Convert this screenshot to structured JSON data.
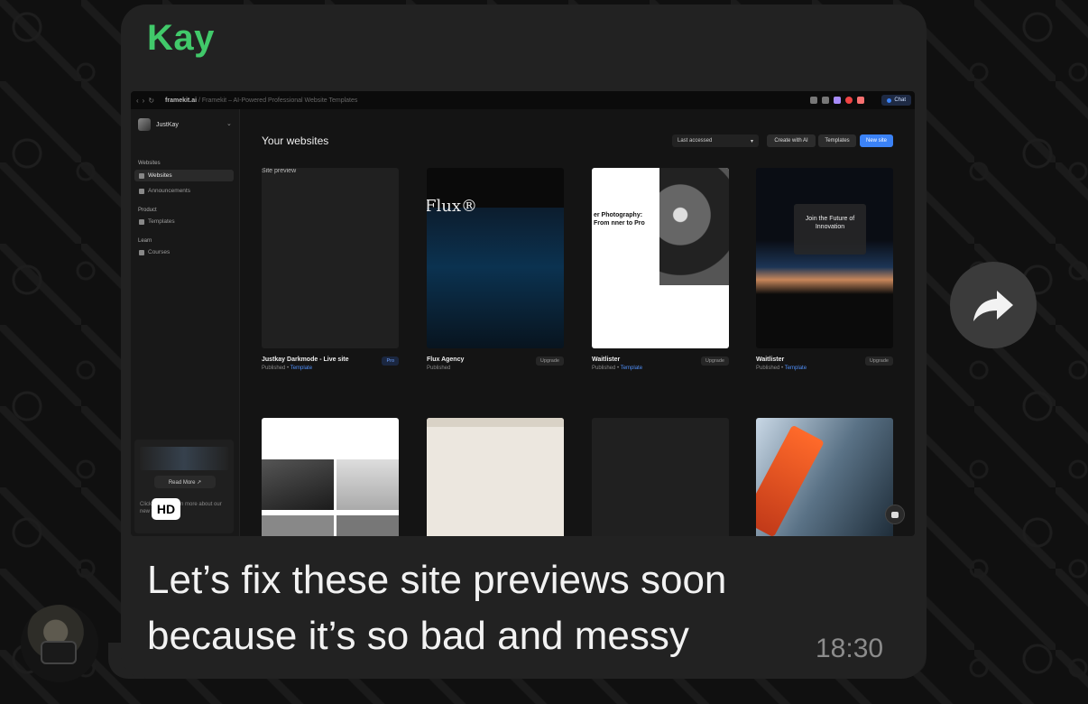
{
  "message": {
    "sender": "Kay",
    "text_lines": [
      "Let’s fix these site previews soon",
      "because it’s so bad and messy"
    ],
    "time": "18:30",
    "hd_badge": "HD"
  },
  "screenshot": {
    "browser": {
      "domain": "framekit.ai",
      "title": " / Framekit – AI-Powered Professional Website Templates",
      "chat_label": "Chat"
    },
    "sidebar": {
      "user": "JustKay",
      "sections": [
        {
          "title": "Websites",
          "items": [
            "Websites",
            "Announcements"
          ]
        },
        {
          "title": "Product",
          "items": [
            "Templates"
          ]
        },
        {
          "title": "Learn",
          "items": [
            "Courses"
          ]
        }
      ],
      "promo": {
        "button": "Read More ↗",
        "text": "Click here to learn more about our new features."
      }
    },
    "main": {
      "title": "Your websites",
      "sort_label": "Last accessed",
      "create_ai": "Create with AI",
      "templates": "Templates",
      "new_site": "New site"
    },
    "cards": [
      {
        "name": "Justkay Darkmode - Live site",
        "status": "Published • ",
        "link": "Template",
        "badge": "Pro",
        "img_alt": "Site preview"
      },
      {
        "name": "Flux Agency",
        "status": "Published",
        "link": "",
        "badge": "Upgrade",
        "logo": "Flux®"
      },
      {
        "name": "Waitlister",
        "status": "Published • ",
        "link": "Template",
        "badge": "Upgrade",
        "headline": "er Photography: From nner to Pro"
      },
      {
        "name": "Waitlister",
        "status": "Published • ",
        "link": "Template",
        "badge": "Upgrade",
        "headline": "Join the Future of Innovation"
      }
    ]
  }
}
